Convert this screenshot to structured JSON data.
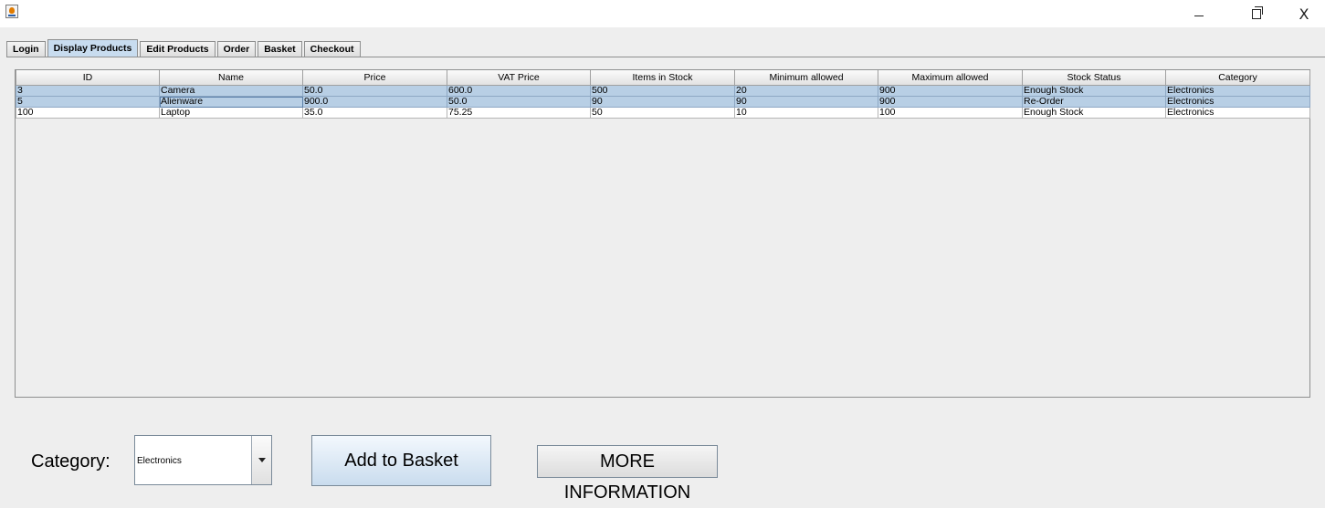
{
  "window": {
    "app_icon": "java-cup-icon",
    "minimize_icon": "minimize-icon",
    "maximize_icon": "maximize-icon",
    "close_symbol": "X"
  },
  "tabs": [
    {
      "label": "Login",
      "selected": false
    },
    {
      "label": "Display Products",
      "selected": true
    },
    {
      "label": "Edit Products",
      "selected": false
    },
    {
      "label": "Order",
      "selected": false
    },
    {
      "label": "Basket",
      "selected": false
    },
    {
      "label": "Checkout",
      "selected": false
    }
  ],
  "table": {
    "columns": [
      "ID",
      "Name",
      "Price",
      "VAT Price",
      "Items in Stock",
      "Minimum allowed",
      "Maximum allowed",
      "Stock Status",
      "Category"
    ],
    "rows": [
      {
        "selected": true,
        "cells": [
          "3",
          "Camera",
          "50.0",
          "600.0",
          "500",
          "20",
          "900",
          "Enough Stock",
          "Electronics"
        ]
      },
      {
        "selected": true,
        "cells": [
          "5",
          "Alienware",
          "900.0",
          "50.0",
          "90",
          "90",
          "900",
          "Re-Order",
          "Electronics"
        ]
      },
      {
        "selected": false,
        "cells": [
          "100",
          "Laptop",
          "35.0",
          "75.25",
          "50",
          "10",
          "100",
          "Enough Stock",
          "Electronics"
        ]
      }
    ]
  },
  "controls": {
    "category_label": "Category:",
    "category_value": "Electronics",
    "add_button": "Add to Basket",
    "more_button": "MORE INFORMATION"
  },
  "colors": {
    "selected_row": "#b8cfe5",
    "selected_tab": "#c8dcef",
    "background": "#eeeeee"
  }
}
